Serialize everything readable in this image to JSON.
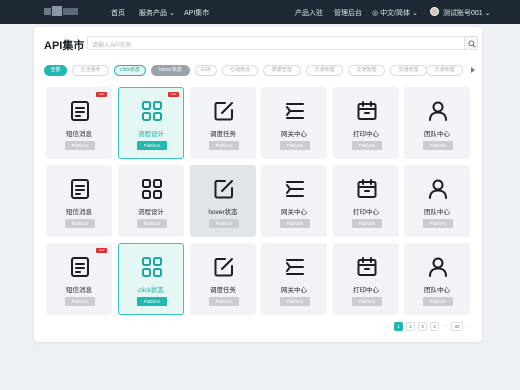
{
  "nav": {
    "home": "首页",
    "services": "服务产品",
    "api_market": "API集市",
    "product_entry": "产品入驻",
    "admin": "管理后台",
    "language": "中文/简体",
    "account": "测试账号001"
  },
  "page": {
    "title": "API集市",
    "search_placeholder": "请输入API名称"
  },
  "filters": [
    {
      "label": "全部",
      "state": "active"
    },
    {
      "label": "生活服务",
      "state": "normal"
    },
    {
      "label": "click状态",
      "state": "click"
    },
    {
      "label": "hover状态",
      "state": "hover"
    },
    {
      "label": "ERP",
      "state": "normal"
    },
    {
      "label": "仓储物流",
      "state": "normal"
    },
    {
      "label": "数据智能",
      "state": "normal"
    },
    {
      "label": "交通地理",
      "state": "normal"
    },
    {
      "label": "交通地理",
      "state": "normal"
    },
    {
      "label": "交通地理",
      "state": "normal"
    },
    {
      "label": "交通地理",
      "state": "normal"
    }
  ],
  "cards": [
    {
      "name": "短信消息",
      "platform": "Platform",
      "icon": "document-icon",
      "badge": "new",
      "state": "normal"
    },
    {
      "name": "流程设计",
      "platform": "Platform",
      "icon": "grid-icon",
      "badge": "new",
      "state": "selected"
    },
    {
      "name": "调度任务",
      "platform": "Platform",
      "icon": "edit-icon",
      "badge": "",
      "state": "normal"
    },
    {
      "name": "网关中心",
      "platform": "Platform",
      "icon": "gateway-icon",
      "badge": "",
      "state": "normal"
    },
    {
      "name": "打印中心",
      "platform": "Platform",
      "icon": "calendar-icon",
      "badge": "",
      "state": "normal"
    },
    {
      "name": "团队中心",
      "platform": "Platform",
      "icon": "user-icon",
      "badge": "",
      "state": "normal"
    },
    {
      "name": "短信消息",
      "platform": "Platform",
      "icon": "document-icon",
      "badge": "",
      "state": "normal"
    },
    {
      "name": "流程设计",
      "platform": "Platform",
      "icon": "grid-icon",
      "badge": "",
      "state": "normal"
    },
    {
      "name": "hover状态",
      "platform": "Platform",
      "icon": "edit-icon",
      "badge": "",
      "state": "hover"
    },
    {
      "name": "网关中心",
      "platform": "Platform",
      "icon": "gateway-icon",
      "badge": "",
      "state": "normal"
    },
    {
      "name": "打印中心",
      "platform": "Platform",
      "icon": "calendar-icon",
      "badge": "",
      "state": "normal"
    },
    {
      "name": "团队中心",
      "platform": "Platform",
      "icon": "user-icon",
      "badge": "",
      "state": "normal"
    },
    {
      "name": "短信消息",
      "platform": "Platform",
      "icon": "document-icon",
      "badge": "new",
      "state": "normal"
    },
    {
      "name": "click状态",
      "platform": "Platform",
      "icon": "grid-icon",
      "badge": "",
      "state": "selected"
    },
    {
      "name": "调度任务",
      "platform": "Platform",
      "icon": "edit-icon",
      "badge": "",
      "state": "normal"
    },
    {
      "name": "网关中心",
      "platform": "Platform",
      "icon": "gateway-icon",
      "badge": "",
      "state": "normal"
    },
    {
      "name": "打印中心",
      "platform": "Platform",
      "icon": "calendar-icon",
      "badge": "",
      "state": "normal"
    },
    {
      "name": "团队中心",
      "platform": "Platform",
      "icon": "user-icon",
      "badge": "",
      "state": "normal"
    }
  ],
  "pagination": {
    "pages": [
      "1",
      "2",
      "3",
      "4",
      "···",
      "30"
    ],
    "current": "1"
  },
  "colors": {
    "accent": "#22b8b0",
    "nav_bg": "#1f2935",
    "badge": "#e03131"
  }
}
